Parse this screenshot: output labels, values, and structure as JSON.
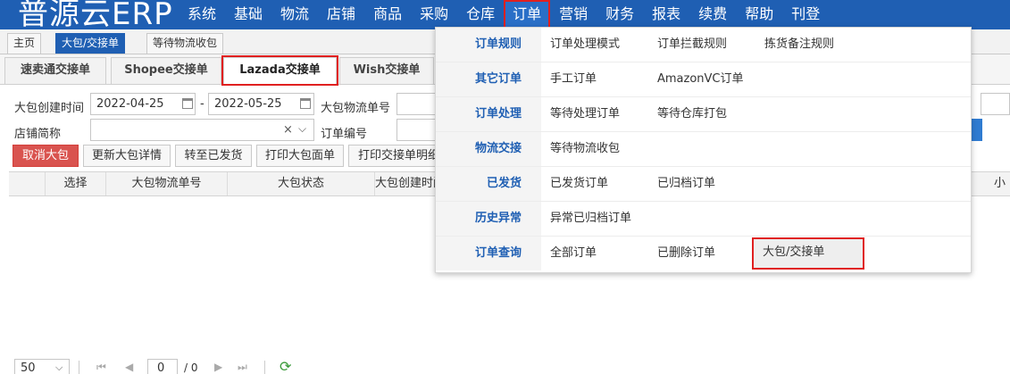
{
  "app": {
    "title": "普源云ERP"
  },
  "nav": {
    "items": [
      "系统",
      "基础",
      "物流",
      "店铺",
      "商品",
      "采购",
      "仓库",
      "订单",
      "营销",
      "财务",
      "报表",
      "续费",
      "帮助",
      "刊登"
    ]
  },
  "window_tabs": [
    {
      "label": "主页"
    },
    {
      "label": "大包/交接单"
    },
    {
      "label": "等待物流收包"
    }
  ],
  "sub_tabs": [
    "速卖通交接单",
    "Shopee交接单",
    "Lazada交接单",
    "Wish交接单"
  ],
  "filters": {
    "bag_created_label": "大包创建时间",
    "date_from": "2022-04-25",
    "date_sep": "-",
    "date_to": "2022-05-25",
    "bag_tracking_label": "大包物流单号",
    "shop_label": "店铺简称",
    "order_no_label": "订单编号",
    "clear_glyph": "×"
  },
  "actions": {
    "cancel_bag": "取消大包",
    "update_bag": "更新大包详情",
    "to_shipped": "转至已发货",
    "print_label": "打印大包面单",
    "print_detail": "打印交接单明细"
  },
  "grid": {
    "columns": [
      "选择",
      "大包物流单号",
      "大包状态",
      "大包创建时间"
    ],
    "right_column_fragment": "小"
  },
  "pager": {
    "page_size": "50",
    "current_page": "0",
    "total_pages": "/ 0"
  },
  "menu": {
    "rows": [
      {
        "header": "订单规则",
        "items": [
          "订单处理模式",
          "订单拦截规则",
          "拣货备注规则"
        ]
      },
      {
        "header": "其它订单",
        "items": [
          "手工订单",
          "AmazonVC订单"
        ]
      },
      {
        "header": "订单处理",
        "items": [
          "等待处理订单",
          "等待仓库打包"
        ]
      },
      {
        "header": "物流交接",
        "items": [
          "等待物流收包"
        ]
      },
      {
        "header": "已发货",
        "items": [
          "已发货订单",
          "已归档订单"
        ]
      },
      {
        "header": "历史异常",
        "items": [
          "异常已归档订单"
        ]
      },
      {
        "header": "订单查询",
        "items": [
          "全部订单",
          "已删除订单",
          "大包/交接单"
        ]
      }
    ]
  },
  "colors": {
    "nav_bg": "#1f5fb3",
    "accent": "#1f5fb3",
    "highlight_border": "#e02020",
    "danger_button": "#d9534f"
  },
  "icons": [
    "calendar-icon",
    "chevron-down-icon",
    "first-page-icon",
    "prev-page-icon",
    "next-page-icon",
    "last-page-icon",
    "refresh-icon"
  ]
}
